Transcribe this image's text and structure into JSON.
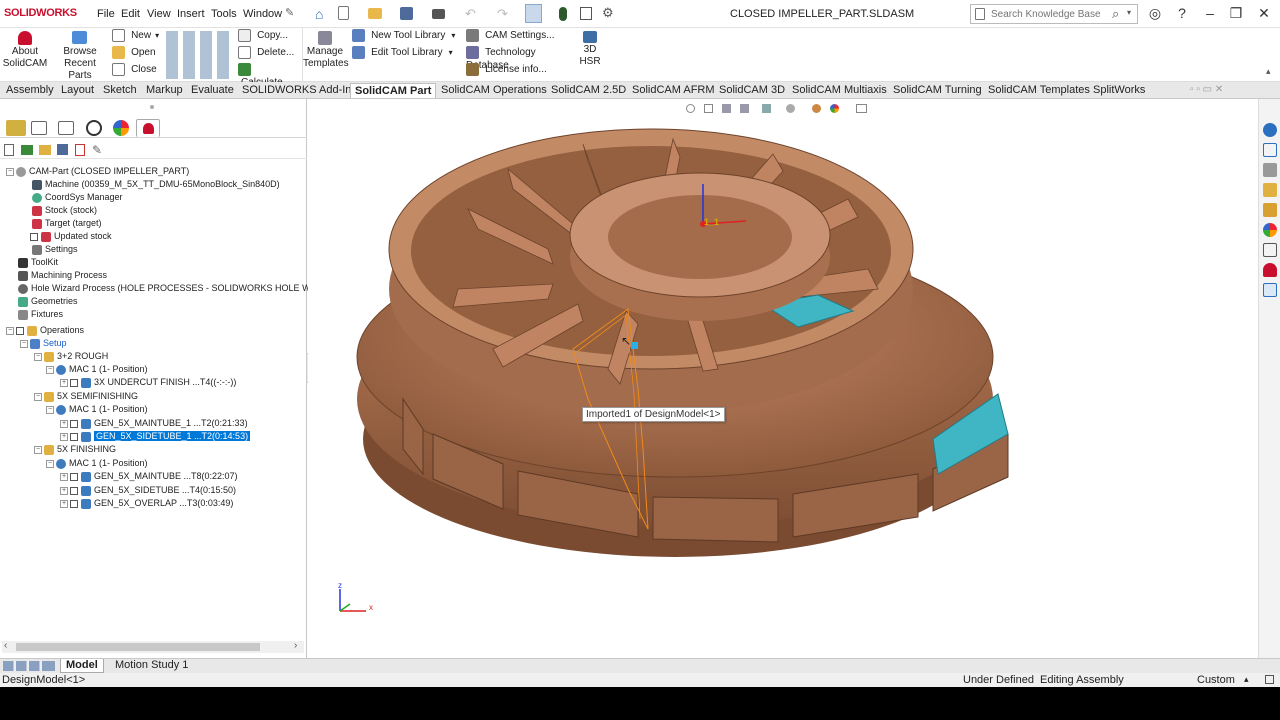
{
  "app": {
    "logo": "SOLIDWORKS",
    "document_title": "CLOSED IMPELLER_PART.SLDASM"
  },
  "menu": [
    "File",
    "Edit",
    "View",
    "Insert",
    "Tools",
    "Window"
  ],
  "search": {
    "placeholder": "Search Knowledge Base"
  },
  "ribbon": {
    "about": "About SolidCAM",
    "browse": "Browse Recent Parts",
    "new": "New",
    "open": "Open",
    "close": "Close",
    "copy": "Copy...",
    "delete": "Delete...",
    "calculate": "Calculate",
    "manage": "Manage Templates",
    "new_tool_library": "New Tool Library",
    "edit_tool_library": "Edit Tool Library",
    "cam_settings": "CAM Settings...",
    "tech_db": "Technology Database",
    "license": "License info...",
    "hsr": "3D HSR"
  },
  "tabs": [
    "Assembly",
    "Layout",
    "Sketch",
    "Markup",
    "Evaluate",
    "SOLIDWORKS Add-Ins",
    "SolidCAM Part",
    "SolidCAM Operations",
    "SolidCAM 2.5D",
    "SolidCAM AFRM",
    "SolidCAM 3D",
    "SolidCAM Multiaxis",
    "SolidCAM Turning",
    "SolidCAM Templates",
    "SplitWorks"
  ],
  "active_tab": "SolidCAM Part",
  "tree": [
    "CAM-Part (CLOSED IMPELLER_PART)",
    "Machine (00359_M_5X_TT_DMU-65MonoBlock_Sin840D)",
    "CoordSys Manager",
    "Stock (stock)",
    "Target (target)",
    "Updated stock",
    "Settings",
    "ToolKit",
    "Machining Process",
    "Hole Wizard Process (HOLE PROCESSES - SOLIDWORKS HOLE WIZARD",
    "Geometries",
    "Fixtures",
    "Operations",
    "Setup",
    "3+2 ROUGH",
    "MAC 1 (1- Position)",
    "3X UNDERCUT FINISH ...T4((-:-:-))",
    "5X SEMIFINISHING",
    "MAC 1 (1- Position)",
    "GEN_5X_MAINTUBE_1 ...T2(0:21:33)",
    "GEN_5X_SIDETUBE_1 ...T2(0:14:53)",
    "5X FINISHING",
    "MAC 1 (1- Position)",
    "GEN_5X_MAINTUBE ...T8(0:22:07)",
    "GEN_5X_SIDETUBE ...T4(0:15:50)",
    "GEN_5X_OVERLAP ...T3(0:03:49)"
  ],
  "viewport": {
    "tooltip": "Imported1 of DesignModel<1>",
    "axis_z": "z",
    "axis_x": "x",
    "triad_label": "1_1"
  },
  "bottom_tabs": [
    "Model",
    "Motion Study 1"
  ],
  "status": {
    "left": "DesignModel<1>",
    "state": "Under Defined",
    "mode": "Editing Assembly",
    "units": "Custom"
  },
  "colors": {
    "part": "#b87a56",
    "highlight": "#40b6c4",
    "selection": "#0078d7",
    "brand": "#c8102e"
  }
}
